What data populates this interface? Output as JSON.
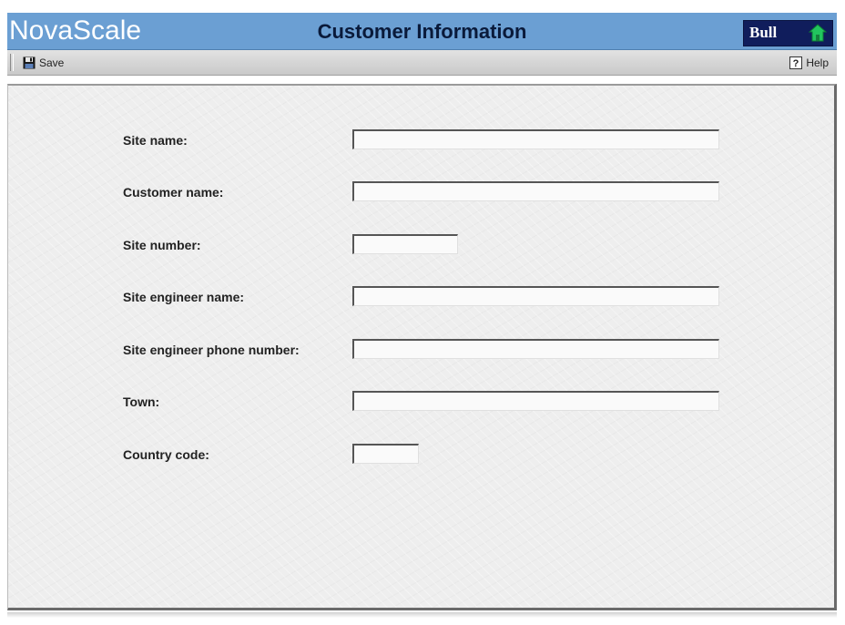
{
  "header": {
    "brand": "NovaScale",
    "title": "Customer Information",
    "logo_text": "Bull",
    "logo_icon": "home-icon"
  },
  "toolbar": {
    "save_label": "Save",
    "save_icon": "floppy-disk-icon",
    "help_label": "Help",
    "help_icon": "question-mark-icon"
  },
  "form": {
    "site_name": {
      "label": "Site name:",
      "value": ""
    },
    "customer_name": {
      "label": "Customer name:",
      "value": ""
    },
    "site_number": {
      "label": "Site number:",
      "value": ""
    },
    "site_engineer_name": {
      "label": "Site engineer name:",
      "value": ""
    },
    "site_engineer_phone": {
      "label": "Site engineer phone number:",
      "value": ""
    },
    "town": {
      "label": "Town:",
      "value": ""
    },
    "country_code": {
      "label": "Country code:",
      "value": ""
    }
  },
  "colors": {
    "header_bg": "#6b9fd3",
    "logo_bg": "#101d5c",
    "logo_icon": "#22c55e",
    "toolbar_bg": "#d4d4d4",
    "content_bg": "#eeeeee"
  }
}
